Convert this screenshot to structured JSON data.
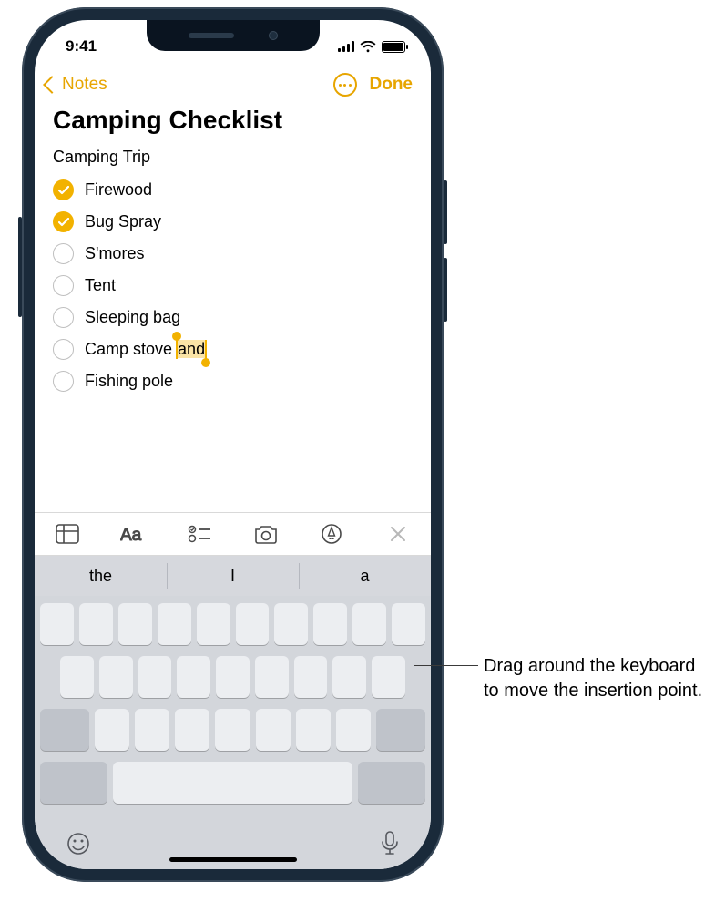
{
  "status": {
    "time": "9:41"
  },
  "nav": {
    "back_label": "Notes",
    "done_label": "Done"
  },
  "note": {
    "title": "Camping Checklist",
    "subtitle": "Camping Trip",
    "items": [
      {
        "label": "Firewood",
        "checked": true
      },
      {
        "label": "Bug Spray",
        "checked": true
      },
      {
        "label": "S'mores",
        "checked": false
      },
      {
        "label": "Tent",
        "checked": false
      },
      {
        "label": "Sleeping bag",
        "checked": false
      },
      {
        "label_pre": "Camp stove ",
        "label_sel": "and",
        "checked": false
      },
      {
        "label": "Fishing pole",
        "checked": false
      }
    ]
  },
  "suggestions": {
    "s0": "the",
    "s1": "I",
    "s2": "a"
  },
  "callout": {
    "text": "Drag around the keyboard to move the insertion point."
  }
}
